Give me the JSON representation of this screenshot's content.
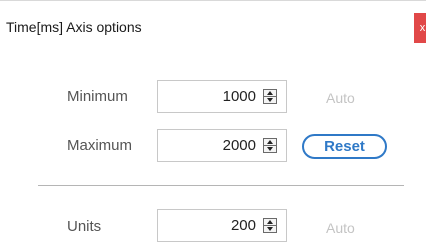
{
  "dialog": {
    "title": "Time[ms] Axis options",
    "close_label": "x"
  },
  "rows": {
    "minimum": {
      "label": "Minimum",
      "value": "1000",
      "auto_label": "Auto"
    },
    "maximum": {
      "label": "Maximum",
      "value": "2000",
      "reset_label": "Reset"
    },
    "units": {
      "label": "Units",
      "value": "200",
      "auto_label": "Auto"
    }
  },
  "colors": {
    "close_bg": "#e14848",
    "accent": "#2f79c7",
    "disabled_text": "#c4c4c4"
  }
}
